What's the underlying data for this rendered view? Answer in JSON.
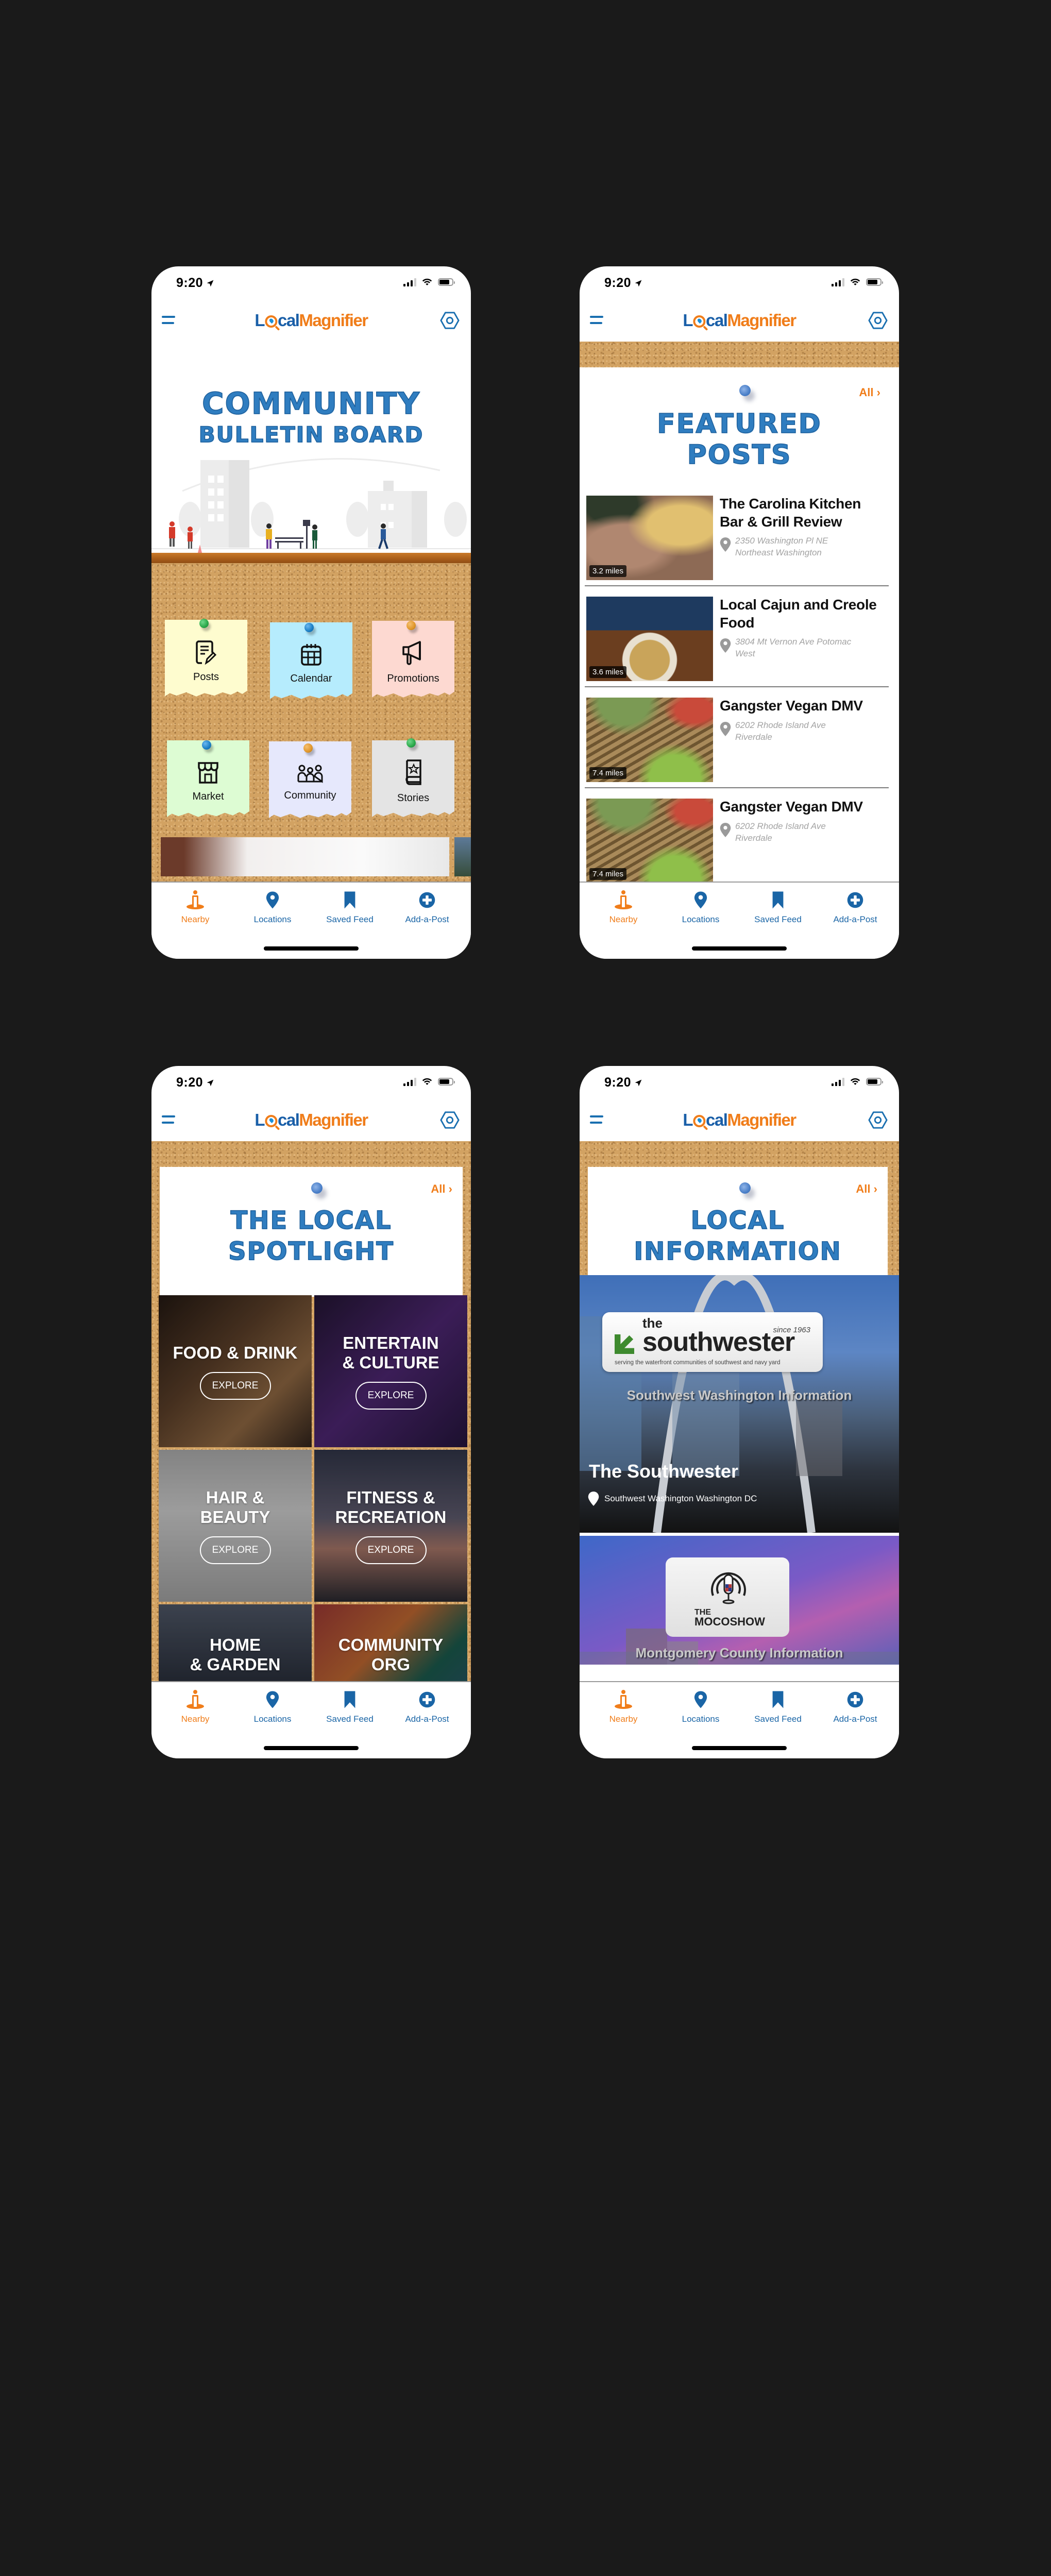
{
  "common": {
    "status_time": "9:20",
    "app_name_part1": "L",
    "app_name_part2": "cal",
    "app_name_part3": "Magnifier",
    "icons": {
      "menu": "hamburger-menu-icon",
      "settings": "hexagon-settings-icon",
      "location_arrow": "location-arrow-icon",
      "signal": "cellular-signal-icon",
      "wifi": "wifi-icon",
      "battery": "battery-icon"
    },
    "colors": {
      "brand_blue": "#1a65a6",
      "brand_orange": "#f07d1a",
      "title_blue": "#2f7dc0",
      "cork": "#d2a262",
      "page_background": "#1a1a1a"
    },
    "tabs": [
      {
        "label": "Nearby",
        "icon": "person-nearby-icon",
        "active": true
      },
      {
        "label": "Locations",
        "icon": "map-pin-icon",
        "active": false
      },
      {
        "label": "Saved Feed",
        "icon": "bookmark-icon",
        "active": false
      },
      {
        "label": "Add-a-Post",
        "icon": "plus-circle-icon",
        "active": false
      }
    ]
  },
  "screen1": {
    "title_line1": "COMMUNITY",
    "title_line2": "BULLETIN BOARD",
    "notes": [
      {
        "label": "Posts",
        "icon": "document-edit-icon",
        "color": "#fefccf",
        "pin": "#2aa84a"
      },
      {
        "label": "Calendar",
        "icon": "calendar-icon",
        "color": "#b6ecfd",
        "pin": "#1a7ec4"
      },
      {
        "label": "Promotions",
        "icon": "megaphone-icon",
        "color": "#fdd9d1",
        "pin": "#e0962a"
      },
      {
        "label": "Market",
        "icon": "storefront-icon",
        "color": "#ddfcd3",
        "pin": "#1a7ec4"
      },
      {
        "label": "Community",
        "icon": "people-group-icon",
        "color": "#e6e8fc",
        "pin": "#e0962a"
      },
      {
        "label": "Stories",
        "icon": "book-star-icon",
        "color": "#e4e4e4",
        "pin": "#2aa84a"
      }
    ]
  },
  "screen2": {
    "all_label": "All",
    "title_line1": "FEATURED",
    "title_line2": "POSTS",
    "posts": [
      {
        "title": "The Carolina Kitchen Bar & Grill Review",
        "address_line1": "2350 Washington Pl NE",
        "address_line2": "Northeast Washington",
        "distance": "3.2 miles"
      },
      {
        "title": "Local Cajun and Creole Food",
        "address_line1": "3804 Mt Vernon Ave Potomac",
        "address_line2": "West",
        "distance": "3.6 miles"
      },
      {
        "title": "Gangster Vegan DMV",
        "address_line1": "6202 Rhode Island Ave",
        "address_line2": "Riverdale",
        "distance": "7.4 miles"
      },
      {
        "title": "Gangster Vegan DMV",
        "address_line1": "6202 Rhode Island Ave",
        "address_line2": "Riverdale",
        "distance": "7.4 miles"
      }
    ]
  },
  "screen3": {
    "all_label": "All",
    "title_line1": "THE LOCAL",
    "title_line2": "SPOTLIGHT",
    "explore_label": "EXPLORE",
    "categories": [
      {
        "line1": "FOOD &  DRINK",
        "line2": "",
        "has_explore": true
      },
      {
        "line1": "ENTERTAIN",
        "line2": "& CULTURE",
        "has_explore": true
      },
      {
        "line1": "HAIR &",
        "line2": "BEAUTY",
        "has_explore": true
      },
      {
        "line1": "FITNESS &",
        "line2": "RECREATION",
        "has_explore": true
      },
      {
        "line1": "HOME",
        "line2": "& GARDEN",
        "has_explore": false
      },
      {
        "line1": "COMMUNITY",
        "line2": "ORG",
        "has_explore": false
      }
    ]
  },
  "screen4": {
    "all_label": "All",
    "title_line1": "LOCAL",
    "title_line2": "INFORMATION",
    "cards": [
      {
        "logo_the": "the",
        "logo_name": "southwester",
        "logo_since": "since 1963",
        "logo_tagline": "serving the waterfront communities of southwest and navy yard",
        "overlay": "Southwest Washington Information",
        "title": "The Southwester",
        "location": "Southwest Washington Washington DC"
      },
      {
        "logo_the": "THE",
        "logo_name": "MOCOSHOW",
        "overlay": "Montgomery County Information"
      }
    ]
  }
}
